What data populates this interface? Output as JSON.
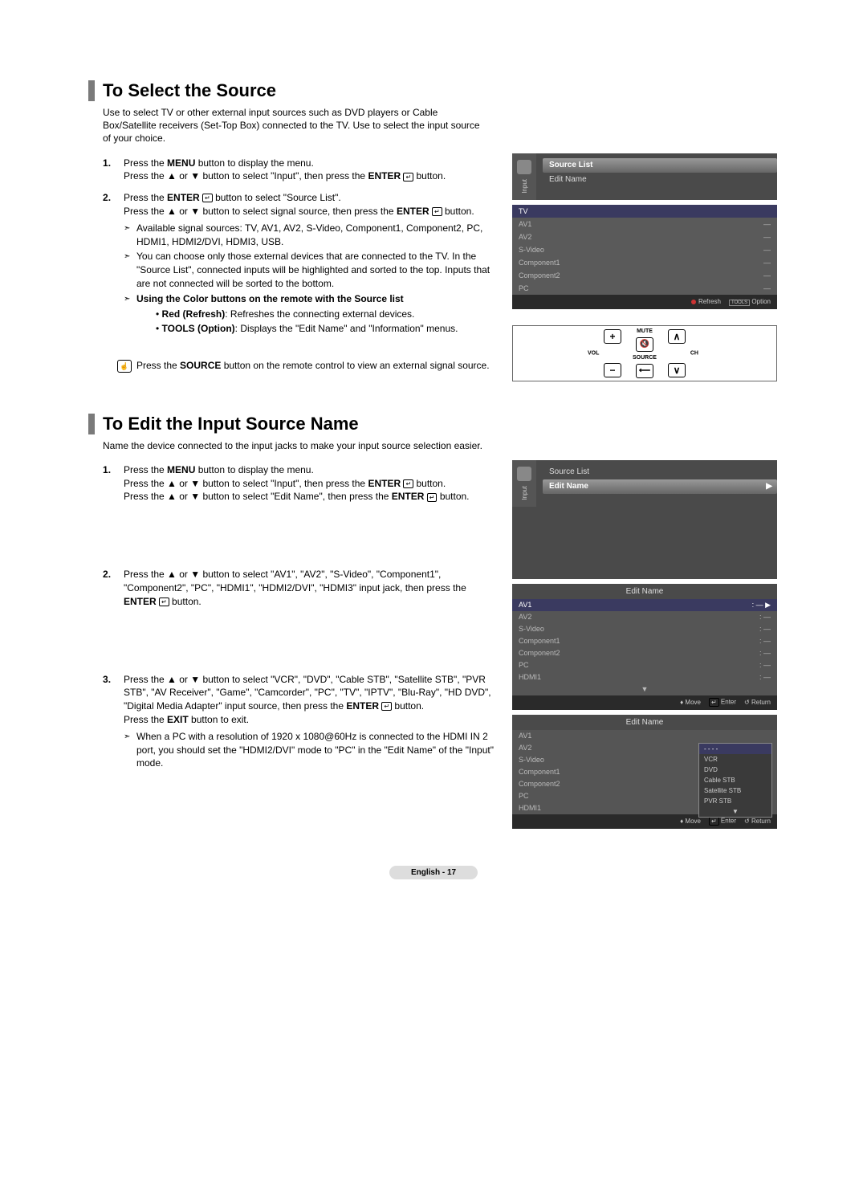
{
  "section1": {
    "title": "To Select the Source",
    "intro": "Use to select TV or other external input sources such as DVD players or Cable Box/Satellite receivers (Set-Top Box) connected to the TV. Use to select the input source of your choice.",
    "step1a": "Press the ",
    "step1b": "MENU",
    "step1c": " button to display the menu.",
    "step1d": "Press the ▲ or ▼ button to select \"Input\", then press the ",
    "step1e": "ENTER",
    "step1f": " button.",
    "step2a": "Press the ",
    "step2b": "ENTER",
    "step2c": " button to select \"Source List\".",
    "step2d": "Press the ▲ or ▼ button to select signal source, then press the ",
    "step2e": "ENTER",
    "step2f": " button.",
    "note1": "Available signal sources: TV, AV1, AV2, S-Video, Component1, Component2, PC, HDMI1, HDMI2/DVI, HDMI3, USB.",
    "note2": "You can choose only those external devices that are connected to the TV. In the \"Source List\", connected inputs will be highlighted and sorted to the top. Inputs that are not connected will be sorted to the bottom.",
    "note3bold": "Using the Color buttons on the remote with the Source list",
    "bullet1a": "Red (Refresh)",
    "bullet1b": ": Refreshes the connecting external devices.",
    "bullet2a": "TOOLS (Option)",
    "bullet2b": ": Displays the \"Edit Name\" and \"Information\" menus.",
    "tip": "Press the ",
    "tipbold": "SOURCE",
    "tip2": " button on the remote control to view an external signal source."
  },
  "screen1": {
    "input_label": "Input",
    "source_list": "Source List",
    "edit_name": "Edit Name",
    "rows": [
      "TV",
      "AV1",
      "AV2",
      "S-Video",
      "Component1",
      "Component2",
      "PC"
    ],
    "dash": "—",
    "refresh": "Refresh",
    "tools": "TOOLS",
    "option": "Option"
  },
  "remote": {
    "mute": "MUTE",
    "vol": "VOL",
    "source": "SOURCE",
    "ch": "CH"
  },
  "section2": {
    "title": "To Edit the Input Source Name",
    "intro": "Name the device connected to the input jacks to make your input source selection easier.",
    "step1a": "Press the ",
    "step1b": "MENU",
    "step1c": " button to display the menu.",
    "step1d": "Press the ▲ or ▼ button to select \"Input\", then press the ",
    "step1e": "ENTER",
    "step1f": " button.",
    "step1g": "Press the ▲ or ▼ button to select \"Edit Name\", then press the ",
    "step1h": "ENTER",
    "step1i": " button.",
    "step2a": "Press the ▲ or ▼ button to select \"AV1\", \"AV2\", \"S-Video\", \"Component1\", \"Component2\", \"PC\", \"HDMI1\", \"HDMI2/DVI\", \"HDMI3\" input jack, then press the ",
    "step2b": "ENTER",
    "step2c": " button.",
    "step3a": "Press the ▲ or ▼ button to select \"VCR\", \"DVD\", \"Cable STB\", \"Satellite STB\", \"PVR STB\", \"AV Receiver\", \"Game\", \"Camcorder\", \"PC\", \"TV\", \"IPTV\", \"Blu-Ray\", \"HD DVD\", \"Digital Media Adapter\" input source, then press the ",
    "step3b": "ENTER",
    "step3c": " button.",
    "step3d": "Press the ",
    "step3e": "EXIT",
    "step3f": " button to exit.",
    "note1": "When a PC with a resolution of 1920 x 1080@60Hz is connected to the HDMI IN 2 port, you should set the \"HDMI2/DVI\" mode to \"PC\" in the \"Edit Name\" of the \"Input\" mode."
  },
  "screen2": {
    "input_label": "Input",
    "source_list": "Source List",
    "edit_name": "Edit Name",
    "edit_name_title": "Edit Name",
    "rows": [
      "AV1",
      "AV2",
      "S-Video",
      "Component1",
      "Component2",
      "PC",
      "HDMI1"
    ],
    "dash": "—",
    "move": "Move",
    "enter": "Enter",
    "return": "Return",
    "popup": [
      "- - - -",
      "VCR",
      "DVD",
      "Cable STB",
      "Satellite STB",
      "PVR STB"
    ],
    "arrow_down": "▼",
    "arrow_up": "▲"
  },
  "footer": "English - 17"
}
